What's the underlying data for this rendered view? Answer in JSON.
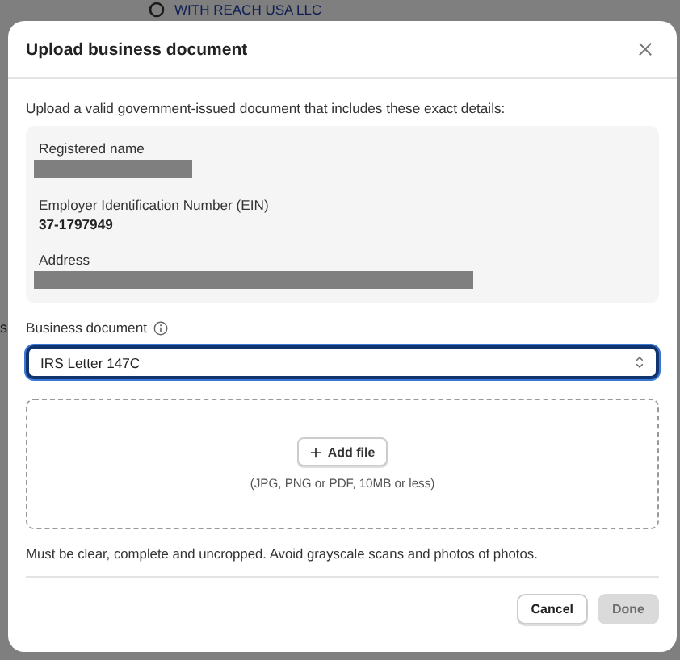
{
  "background": {
    "heading": "WITH REACH USA LLC",
    "edge_text": "s"
  },
  "dialog": {
    "title": "Upload business document",
    "intro": "Upload a valid government-issued document that includes these exact details:",
    "details": [
      {
        "label": "Registered name",
        "kind": "redacted"
      },
      {
        "label": "Employer Identification Number (EIN)",
        "kind": "text",
        "value": "37-1797949"
      },
      {
        "label": "Address",
        "kind": "redacted"
      }
    ],
    "document_field": {
      "label": "Business document",
      "value": "IRS Letter 147C",
      "focused": true
    },
    "upload": {
      "button": "Add file",
      "hint": "(JPG, PNG or PDF, 10MB or less)"
    },
    "note": "Must be clear, complete and uncropped. Avoid grayscale scans and photos of photos.",
    "buttons": [
      {
        "label": "Cancel",
        "kind": "secondary",
        "disabled": false
      },
      {
        "label": "Done",
        "kind": "primary",
        "disabled": true
      }
    ]
  }
}
